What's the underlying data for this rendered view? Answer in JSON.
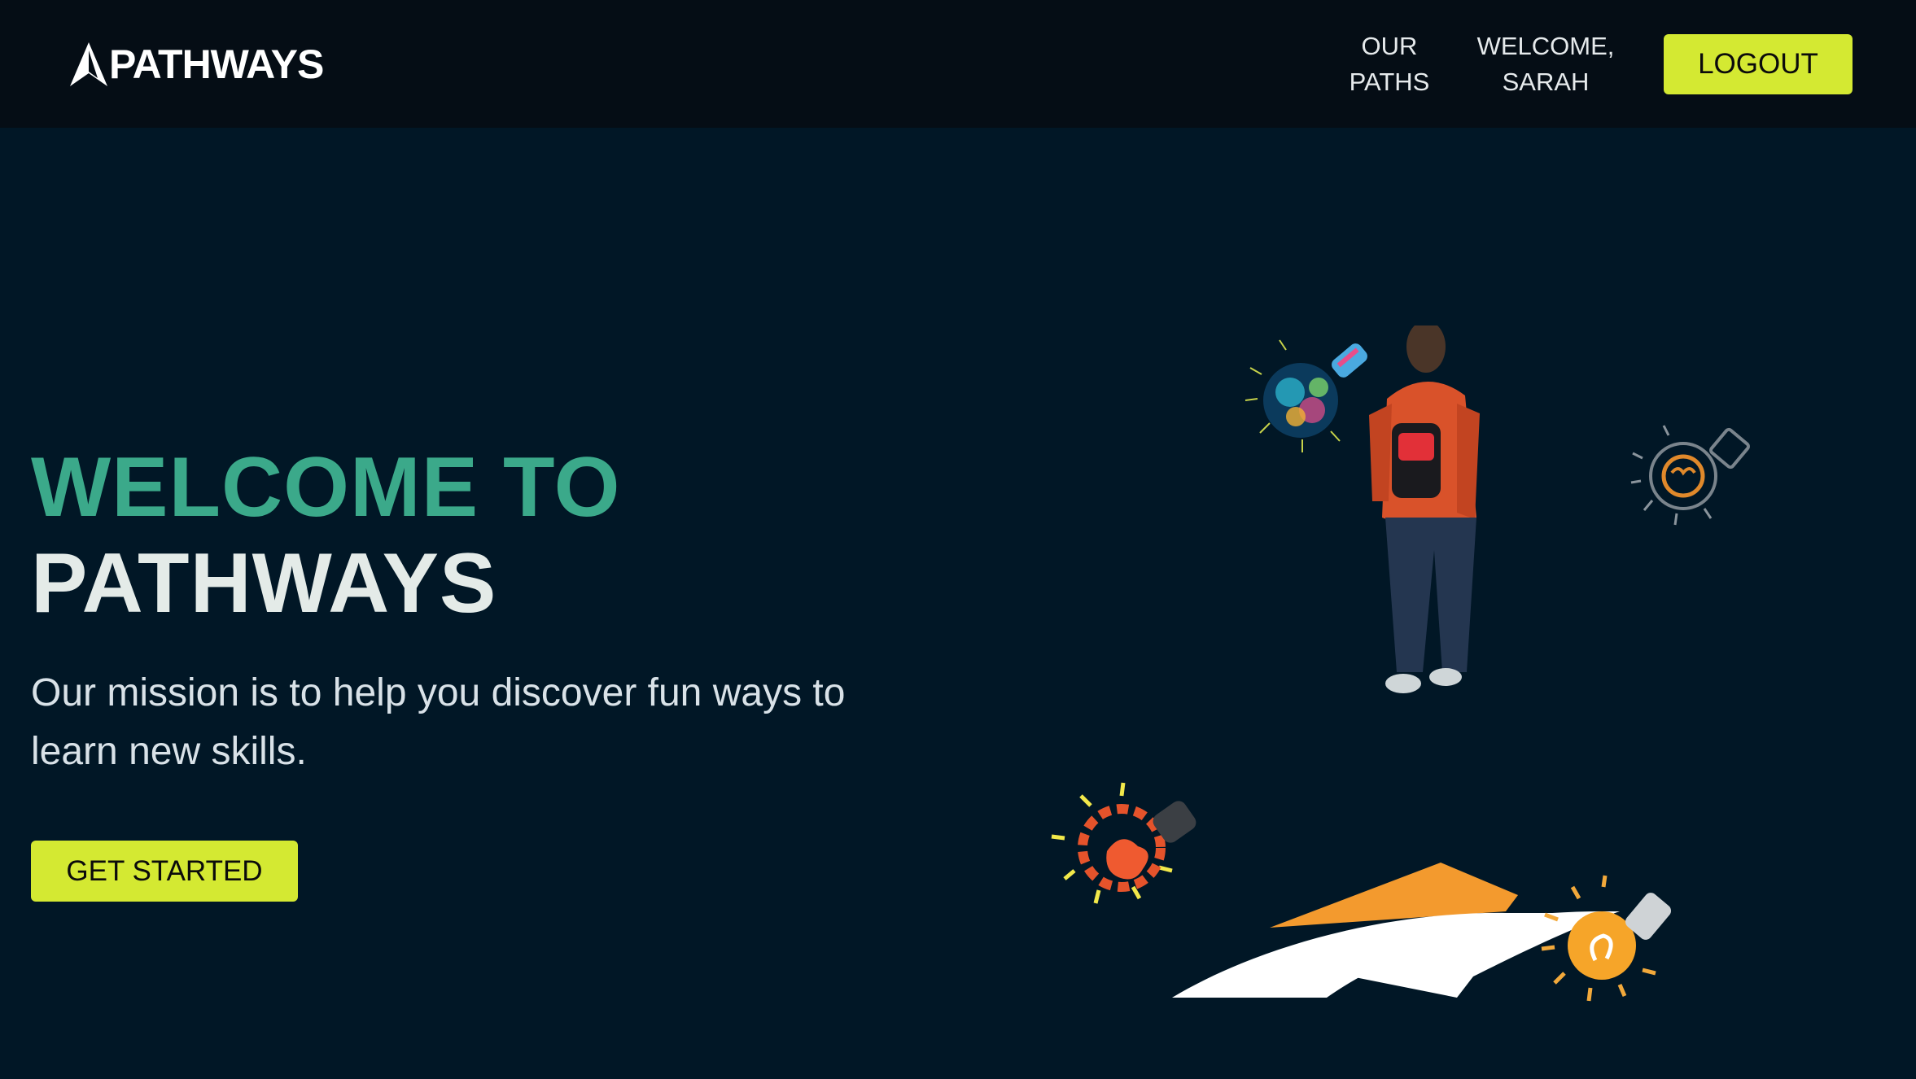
{
  "header": {
    "logo_text": "PATHWAYS",
    "nav": {
      "our_paths": "OUR PATHS",
      "welcome": "WELCOME, SARAH"
    },
    "logout_label": "LOGOUT"
  },
  "hero": {
    "title_line1": "WELCOME TO",
    "title_line2": "PATHWAYS",
    "mission": "Our mission is to help you discover fun ways to learn new skills.",
    "cta_label": "GET STARTED"
  },
  "colors": {
    "header_bg": "#050d15",
    "page_bg": "#011726",
    "accent_lime": "#d4e932",
    "title_green": "#3ba98a",
    "title_white": "#e4ebe8"
  },
  "icons": [
    "logo-arrow-icon",
    "wordcloud-bulb-icon",
    "brain-bulb-icon",
    "gear-brain-icon",
    "glowing-bulb-icon"
  ]
}
